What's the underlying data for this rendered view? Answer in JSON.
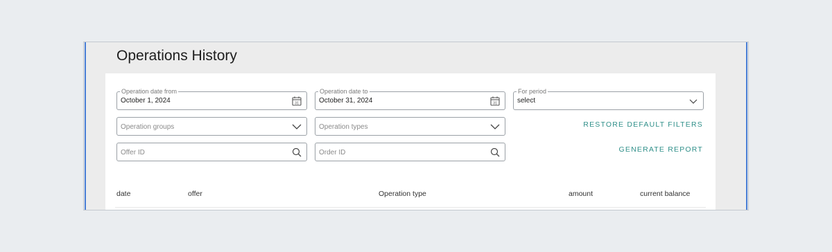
{
  "page": {
    "title": "Operations History"
  },
  "filters": {
    "date_from": {
      "legend": "Operation date from",
      "value": "October 1, 2024"
    },
    "date_to": {
      "legend": "Operation date to",
      "value": "October 31, 2024"
    },
    "period": {
      "legend": "For period",
      "value": "select"
    },
    "operation_groups": {
      "placeholder": "Operation groups"
    },
    "operation_types": {
      "placeholder": "Operation types"
    },
    "offer_id": {
      "placeholder": "Offer ID"
    },
    "order_id": {
      "placeholder": "Order ID"
    },
    "restore_label": "RESTORE DEFAULT FILTERS",
    "generate_label": "GENERATE REPORT"
  },
  "table": {
    "columns": [
      "date",
      "offer",
      "Operation type",
      "amount",
      "current balance"
    ]
  },
  "icons": {
    "calendar": "calendar-icon",
    "chevron": "chevron-down-icon",
    "search": "search-icon"
  },
  "colors": {
    "accent": "#2f8f89",
    "window_edge": "#4a7fd6",
    "background": "#eaedf0"
  }
}
